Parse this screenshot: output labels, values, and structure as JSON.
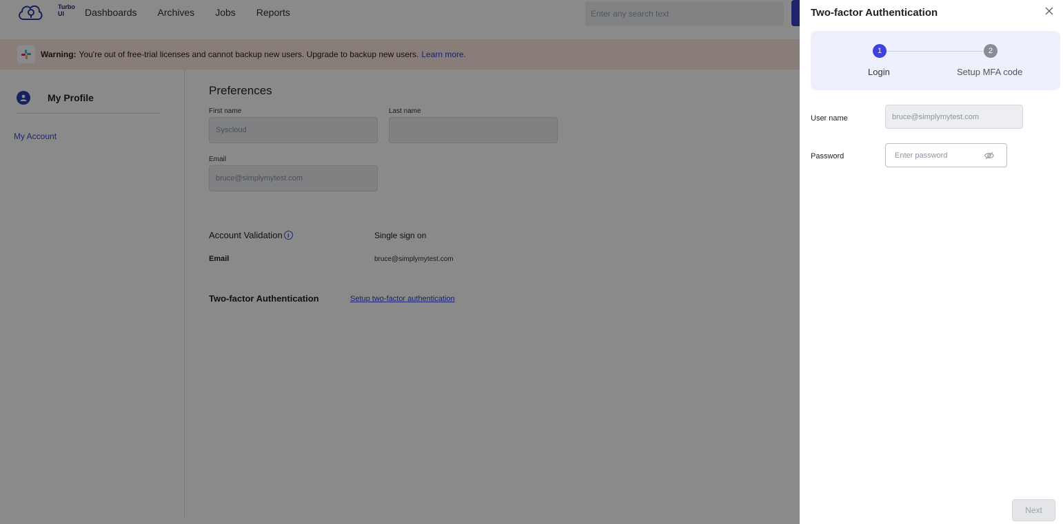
{
  "app": {
    "logo_text": "Turbo UI",
    "nav": [
      "Dashboards",
      "Archives",
      "Jobs",
      "Reports"
    ],
    "search_placeholder": "Enter any search text"
  },
  "warning": {
    "label": "Warning:",
    "message": "You're out of free-trial licenses and cannot backup new users. Upgrade to backup new users.",
    "link": "Learn more."
  },
  "sidebar": {
    "title": "My Profile",
    "items": [
      "My Account"
    ]
  },
  "preferences": {
    "title": "Preferences",
    "first_name_label": "First name",
    "first_name_value": "Syscloud",
    "last_name_label": "Last name",
    "last_name_value": "",
    "email_label": "Email",
    "email_value": "bruce@simplymytest.com"
  },
  "account_validation": {
    "title": "Account Validation",
    "info_icon": "i",
    "sso_title": "Single sign on",
    "email_label": "Email",
    "email_value": "bruce@simplymytest.com"
  },
  "two_factor": {
    "title": "Two-factor Authentication",
    "setup_link": "Setup two-factor authentication"
  },
  "drawer": {
    "title": "Two-factor Authentication",
    "steps": [
      {
        "number": "1",
        "label": "Login"
      },
      {
        "number": "2",
        "label": "Setup MFA code"
      }
    ],
    "username_label": "User name",
    "username_value": "bruce@simplymytest.com",
    "password_label": "Password",
    "password_placeholder": "Enter password",
    "next_label": "Next"
  },
  "colors": {
    "accent": "#3e41e0",
    "link": "#2c3bd6",
    "warning_bg": "#fbe7de",
    "stepper_bg": "#eef0fd"
  }
}
